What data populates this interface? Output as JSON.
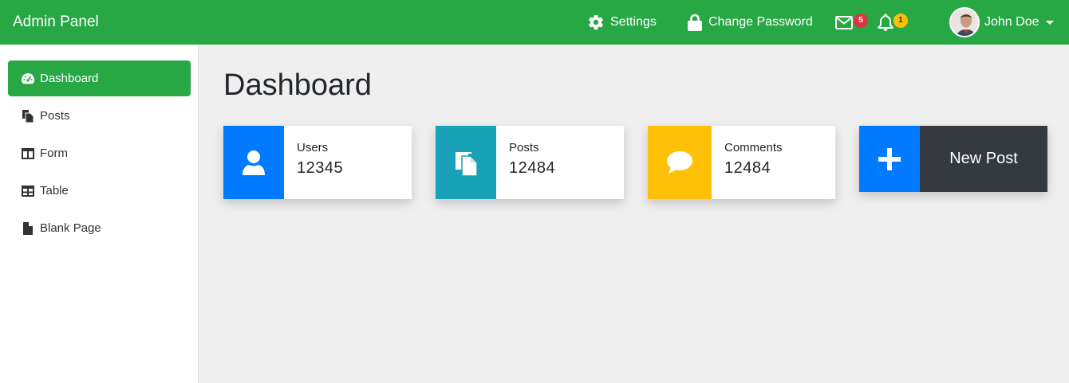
{
  "header": {
    "brand": "Admin Panel",
    "settings_label": "Settings",
    "change_password_label": "Change Password",
    "messages_count": "5",
    "notifications_count": "1",
    "user_name": "John Doe"
  },
  "sidebar": {
    "items": [
      {
        "label": "Dashboard",
        "icon": "dashboard-icon",
        "active": true
      },
      {
        "label": "Posts",
        "icon": "copy-icon"
      },
      {
        "label": "Form",
        "icon": "columns-icon"
      },
      {
        "label": "Table",
        "icon": "table-icon"
      },
      {
        "label": "Blank Page",
        "icon": "file-icon"
      }
    ]
  },
  "main": {
    "title": "Dashboard",
    "cards": [
      {
        "label": "Users",
        "value": "12345",
        "icon": "user-icon",
        "color": "#007bff"
      },
      {
        "label": "Posts",
        "value": "12484",
        "icon": "copy-icon",
        "color": "#17a2b8"
      },
      {
        "label": "Comments",
        "value": "12484",
        "icon": "comment-icon",
        "color": "#ffc107"
      }
    ],
    "new_post_label": "New Post"
  },
  "colors": {
    "primary_green": "#28a745",
    "blue": "#007bff",
    "teal": "#17a2b8",
    "yellow": "#ffc107",
    "dark": "#343a40"
  }
}
